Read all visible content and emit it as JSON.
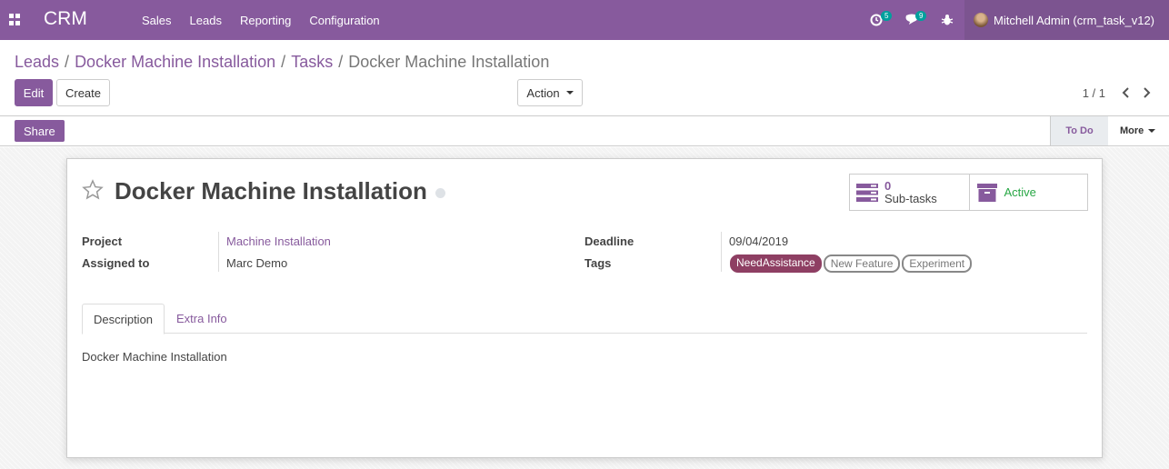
{
  "navbar": {
    "brand": "CRM",
    "menu": [
      "Sales",
      "Leads",
      "Reporting",
      "Configuration"
    ],
    "activity_count": "5",
    "message_count": "9",
    "user_name": "Mitchell Admin (crm_task_v12)"
  },
  "breadcrumb": {
    "items": [
      "Leads",
      "Docker Machine Installation",
      "Tasks"
    ],
    "current": "Docker Machine Installation"
  },
  "toolbar": {
    "edit_label": "Edit",
    "create_label": "Create",
    "action_label": "Action",
    "pager_value": "1 / 1"
  },
  "statusbar": {
    "share_label": "Share",
    "stage": "To Do",
    "more_label": "More"
  },
  "record": {
    "title": "Docker Machine Installation",
    "subtasks_count": "0",
    "subtasks_label": "Sub-tasks",
    "active_label": "Active",
    "fields": {
      "project_label": "Project",
      "project_value": "Machine Installation",
      "assigned_label": "Assigned to",
      "assigned_value": "Marc Demo",
      "deadline_label": "Deadline",
      "deadline_value": "09/04/2019",
      "tags_label": "Tags"
    },
    "tags": [
      "NeedAssistance",
      "New Feature",
      "Experiment"
    ],
    "tabs": [
      "Description",
      "Extra Info"
    ],
    "description": "Docker Machine Installation"
  },
  "colors": {
    "brand": "#875a9d",
    "tag_need_assistance": "#8e3f63",
    "active": "#28a745"
  }
}
